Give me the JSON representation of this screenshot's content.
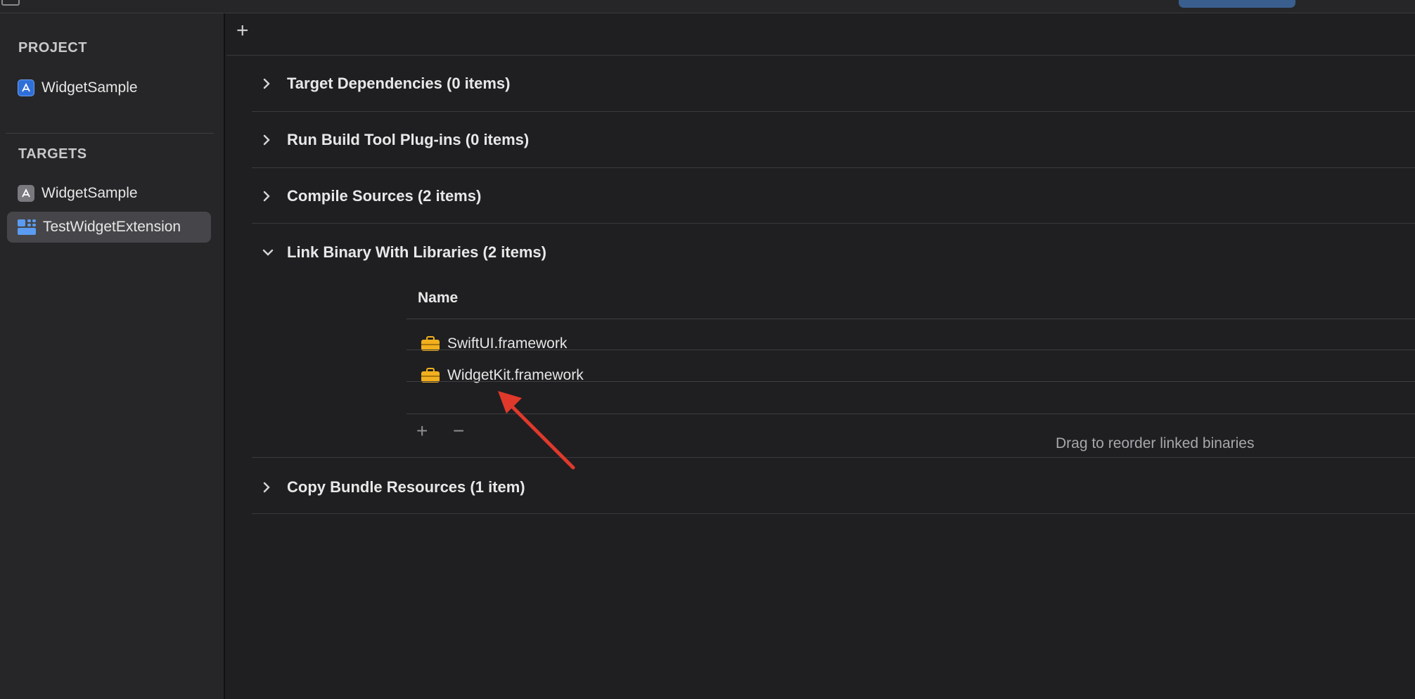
{
  "sidebar": {
    "project_header": "PROJECT",
    "project_item": {
      "label": "WidgetSample",
      "icon": "app-project-icon"
    },
    "targets_header": "TARGETS",
    "target_items": [
      {
        "label": "WidgetSample",
        "icon": "app-target-icon",
        "selected": false
      },
      {
        "label": "TestWidgetExtension",
        "icon": "widget-extension-icon",
        "selected": true
      }
    ]
  },
  "main": {
    "add_phase_label": "+",
    "phases": [
      {
        "label": "Target Dependencies (0 items)",
        "expanded": false
      },
      {
        "label": "Run Build Tool Plug-ins (0 items)",
        "expanded": false
      },
      {
        "label": "Compile Sources (2 items)",
        "expanded": false
      },
      {
        "label": "Link Binary With Libraries (2 items)",
        "expanded": true
      },
      {
        "label": "Copy Bundle Resources (1 item)",
        "expanded": false
      }
    ],
    "link_table": {
      "column_name": "Name",
      "rows": [
        {
          "label": "SwiftUI.framework",
          "icon": "toolbox-icon"
        },
        {
          "label": "WidgetKit.framework",
          "icon": "toolbox-icon"
        }
      ],
      "add_label": "+",
      "remove_label": "−",
      "hint": "Drag to reorder linked binaries"
    }
  },
  "colors": {
    "accent_blue": "#2f6fd8",
    "annotation_red": "#e0392b",
    "toolbox_yellow": "#f2b01e",
    "selection_gray": "#46464a"
  }
}
